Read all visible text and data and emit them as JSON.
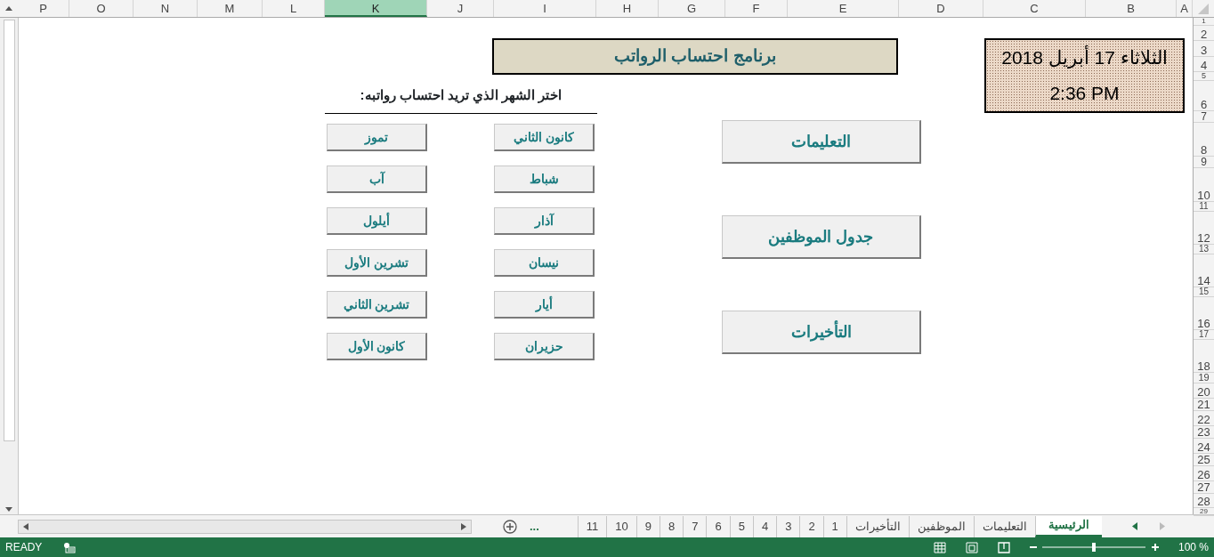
{
  "column_headers": [
    {
      "label": "A",
      "selected": false
    },
    {
      "label": "B",
      "selected": false
    },
    {
      "label": "C",
      "selected": false
    },
    {
      "label": "D",
      "selected": false
    },
    {
      "label": "E",
      "selected": false
    },
    {
      "label": "F",
      "selected": false
    },
    {
      "label": "G",
      "selected": false
    },
    {
      "label": "H",
      "selected": false
    },
    {
      "label": "I",
      "selected": false
    },
    {
      "label": "J",
      "selected": false
    },
    {
      "label": "K",
      "selected": true
    },
    {
      "label": "L",
      "selected": false
    },
    {
      "label": "M",
      "selected": false
    },
    {
      "label": "N",
      "selected": false
    },
    {
      "label": "O",
      "selected": false
    },
    {
      "label": "P",
      "selected": false
    }
  ],
  "row_headers": [
    "1",
    "2",
    "3",
    "4",
    "5",
    "6",
    "7",
    "8",
    "9",
    "10",
    "11",
    "12",
    "13",
    "14",
    "15",
    "16",
    "17",
    "18",
    "19",
    "20",
    "21",
    "22",
    "23",
    "24",
    "25",
    "26",
    "27",
    "28",
    "29"
  ],
  "title": "برنامج احتساب الرواتب",
  "datetime": {
    "date": "الثلاثاء 17 أبريل 2018",
    "time": "2:36 PM"
  },
  "instruction": "اختر الشهر الذي تريد احتساب رواتبه:",
  "months": [
    "كانون الثاني",
    "تموز",
    "شباط",
    "آب",
    "آذار",
    "أيلول",
    "نيسان",
    "تشرين الأول",
    "أيار",
    "تشرين الثاني",
    "حزيران",
    "كانون الأول"
  ],
  "action_buttons": [
    "التعليمات",
    "جدول الموظفين",
    "التأخيرات"
  ],
  "sheet_tabs": [
    {
      "label": "الرئيسية",
      "selected": true
    },
    {
      "label": "التعليمات",
      "selected": false
    },
    {
      "label": "الموظفين",
      "selected": false
    },
    {
      "label": "التأخيرات",
      "selected": false
    },
    {
      "label": "1",
      "selected": false
    },
    {
      "label": "2",
      "selected": false
    },
    {
      "label": "3",
      "selected": false
    },
    {
      "label": "4",
      "selected": false
    },
    {
      "label": "5",
      "selected": false
    },
    {
      "label": "6",
      "selected": false
    },
    {
      "label": "7",
      "selected": false
    },
    {
      "label": "8",
      "selected": false
    },
    {
      "label": "9",
      "selected": false
    },
    {
      "label": "10",
      "selected": false
    },
    {
      "label": "11",
      "selected": false
    }
  ],
  "more_tabs": "...",
  "status_bar": {
    "mode": "READY",
    "zoom": "100 %",
    "zoom_slider": {
      "level": 0.5
    }
  }
}
